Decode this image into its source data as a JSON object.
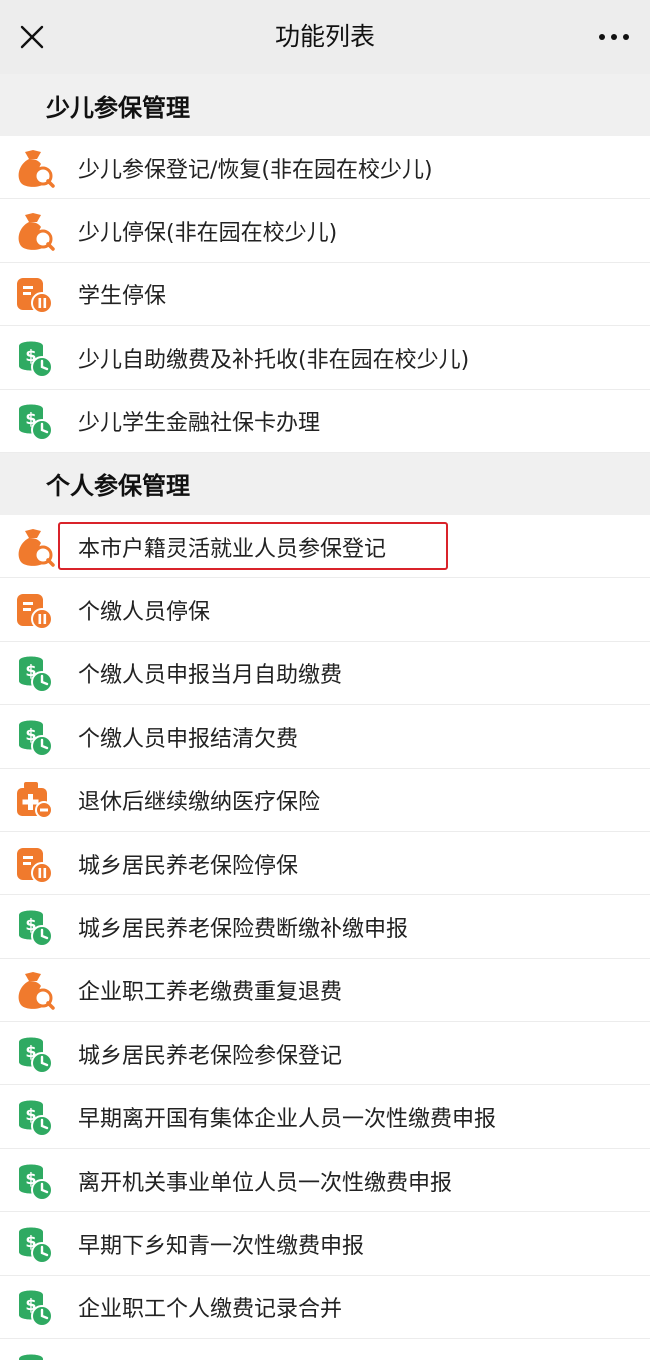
{
  "nav": {
    "title": "功能列表",
    "close_icon": "close-icon",
    "more_icon": "more-icon"
  },
  "colors": {
    "orange": "#f07a2d",
    "green": "#2faa62",
    "highlight": "#d9232a"
  },
  "sections": [
    {
      "title": "少儿参保管理",
      "items": [
        {
          "label": "少儿参保登记/恢复(非在园在校少儿)",
          "icon": "money-bag-search-icon"
        },
        {
          "label": "少儿停保(非在园在校少儿)",
          "icon": "money-bag-search-icon"
        },
        {
          "label": "学生停保",
          "icon": "document-pause-icon"
        },
        {
          "label": "少儿自助缴费及补托收(非在园在校少儿)",
          "icon": "coin-clock-icon"
        },
        {
          "label": "少儿学生金融社保卡办理",
          "icon": "coin-clock-icon"
        }
      ]
    },
    {
      "title": "个人参保管理",
      "items": [
        {
          "label": "本市户籍灵活就业人员参保登记",
          "icon": "money-bag-search-icon",
          "highlighted": true
        },
        {
          "label": "个缴人员停保",
          "icon": "document-pause-icon"
        },
        {
          "label": "个缴人员申报当月自助缴费",
          "icon": "coin-clock-icon"
        },
        {
          "label": "个缴人员申报结清欠费",
          "icon": "coin-clock-icon"
        },
        {
          "label": "退休后继续缴纳医疗保险",
          "icon": "medical-kit-icon"
        },
        {
          "label": "城乡居民养老保险停保",
          "icon": "document-pause-icon"
        },
        {
          "label": "城乡居民养老保险费断缴补缴申报",
          "icon": "coin-clock-icon"
        },
        {
          "label": "企业职工养老缴费重复退费",
          "icon": "money-bag-search-icon"
        },
        {
          "label": "城乡居民养老保险参保登记",
          "icon": "coin-clock-icon"
        },
        {
          "label": "早期离开国有集体企业人员一次性缴费申报",
          "icon": "coin-clock-icon"
        },
        {
          "label": "离开机关事业单位人员一次性缴费申报",
          "icon": "coin-clock-icon"
        },
        {
          "label": "早期下乡知青一次性缴费申报",
          "icon": "coin-clock-icon"
        },
        {
          "label": "企业职工个人缴费记录合并",
          "icon": "coin-clock-icon"
        },
        {
          "label": "",
          "icon": "coin-clock-icon"
        }
      ]
    }
  ]
}
